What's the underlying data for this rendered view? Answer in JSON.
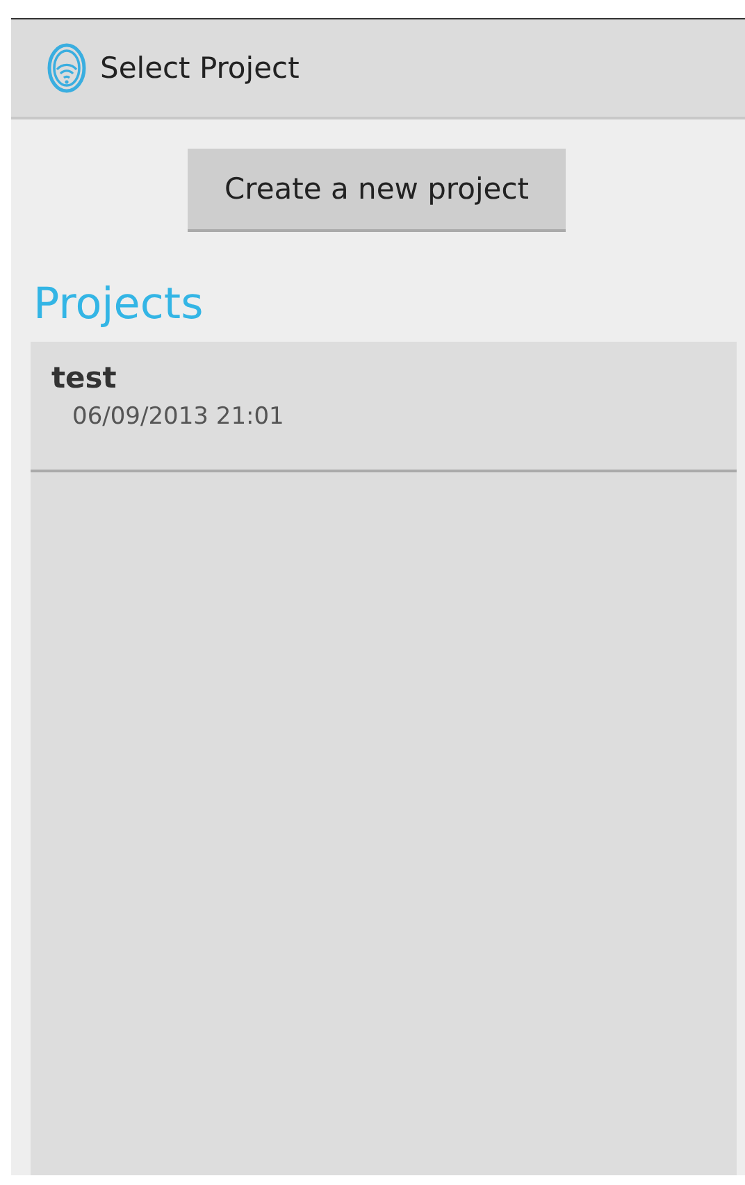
{
  "action_bar": {
    "title": "Select Project"
  },
  "create_button": {
    "label": "Create a new project"
  },
  "projects": {
    "heading": "Projects",
    "items": [
      {
        "name": "test",
        "date": "06/09/2013 21:01"
      }
    ]
  }
}
